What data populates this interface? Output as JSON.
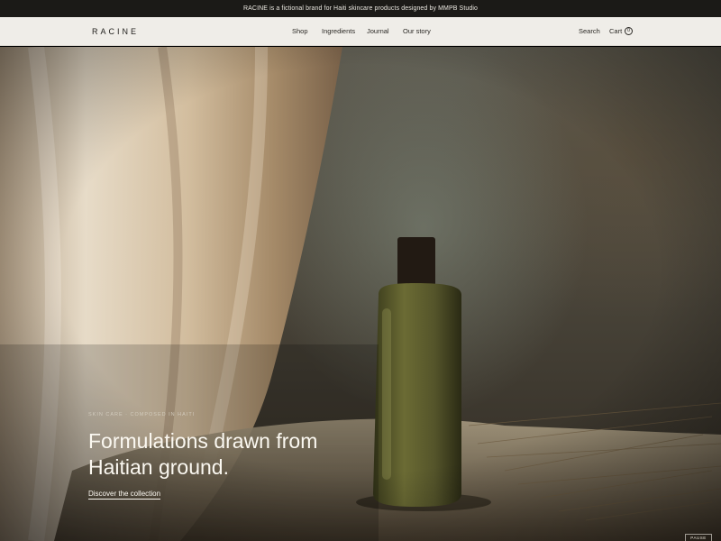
{
  "announcement": {
    "text": "RACINE is a fictional brand for Haiti skincare products designed by MMPB Studio"
  },
  "header": {
    "logo": "RACINE",
    "nav": [
      {
        "label": "Shop"
      },
      {
        "label": "Ingredients"
      },
      {
        "label": "Journal"
      },
      {
        "label": "Our story"
      }
    ],
    "search_label": "Search",
    "cart_label": "Cart",
    "cart_count": "0"
  },
  "hero": {
    "eyebrow": "SKIN CARE · COMPOSED IN HAITI",
    "headline": "Formulations drawn from Haitian ground.",
    "cta_label": "Discover the collection",
    "badge": "PAUSE"
  },
  "colors": {
    "announcement_bg": "#1b1a17",
    "header_bg": "#efede8",
    "text_dark": "#1f1e1b",
    "hero_text": "#fbf8f1"
  },
  "icons": {
    "hero_image": "bottle-still-life-photo"
  }
}
